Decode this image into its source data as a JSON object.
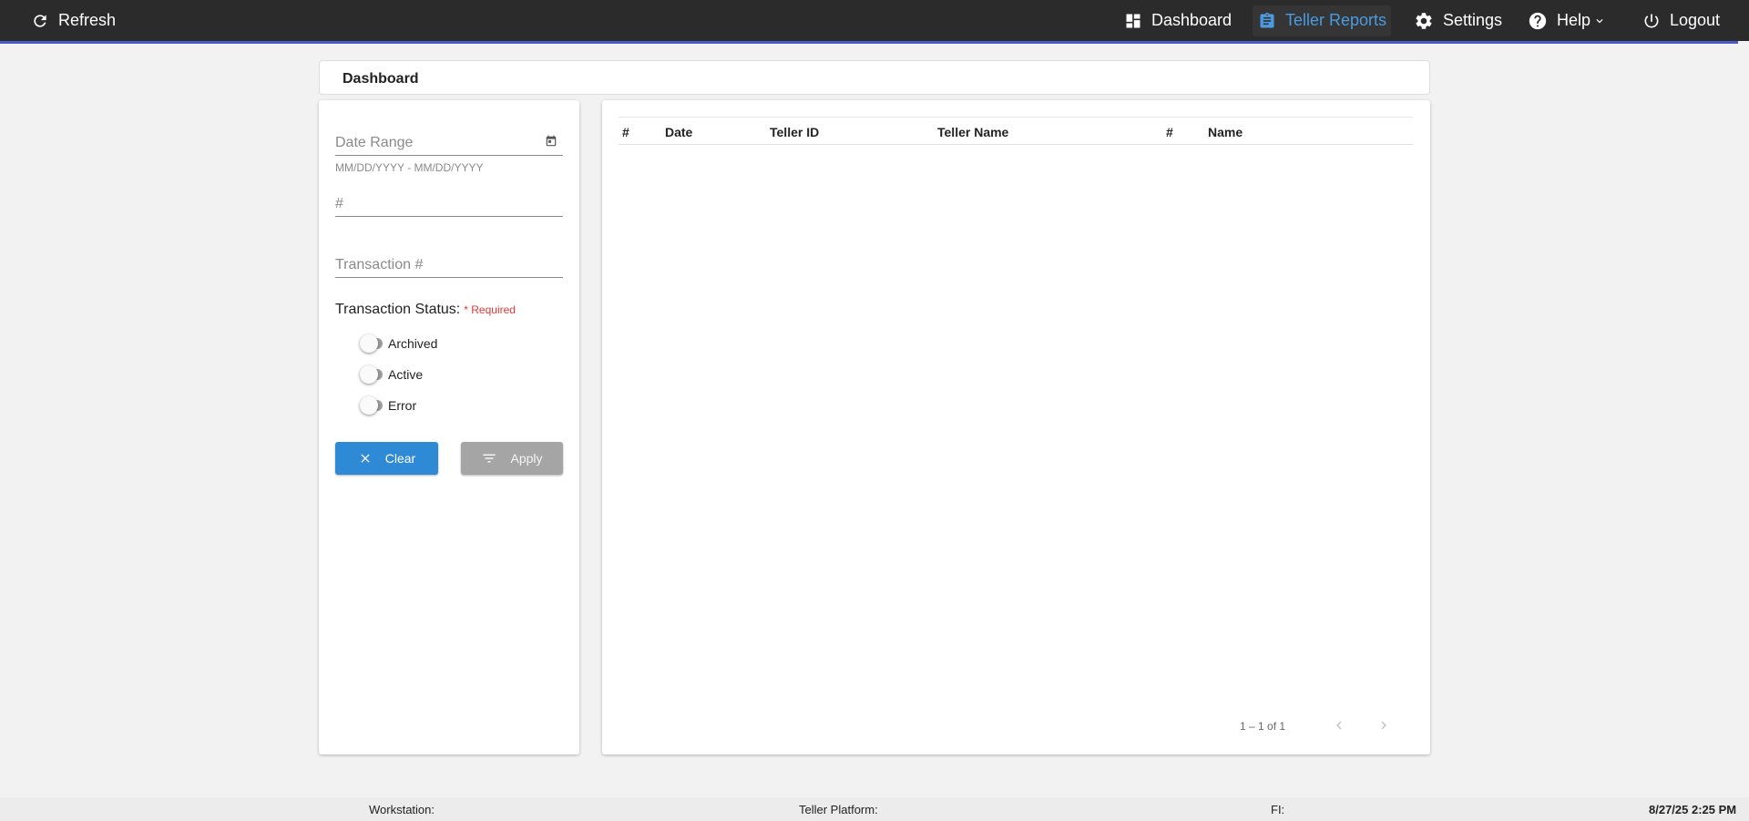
{
  "topbar": {
    "refresh_label": "Refresh",
    "nav": [
      {
        "label": "Dashboard",
        "icon": "dashboard-icon"
      },
      {
        "label": "Teller Reports",
        "icon": "clipboard-icon",
        "active": true
      },
      {
        "label": "Settings",
        "icon": "gear-icon"
      },
      {
        "label": "Help",
        "icon": "help-icon"
      },
      {
        "label": "Logout",
        "icon": "power-icon"
      }
    ],
    "accent_color": "#4a9be0",
    "underline_color": "#4a5cc4"
  },
  "breadcrumb": {
    "title": "Dashboard"
  },
  "filters": {
    "date_range": {
      "placeholder": "Date Range",
      "hint": "MM/DD/YYYY - MM/DD/YYYY",
      "value": ""
    },
    "number": {
      "placeholder": "#",
      "value": ""
    },
    "transaction": {
      "placeholder": "Transaction #",
      "value": ""
    },
    "status_label": "Transaction Status:",
    "required_label": "* Required",
    "toggles": [
      {
        "label": "Archived",
        "checked": false
      },
      {
        "label": "Active",
        "checked": false
      },
      {
        "label": "Error",
        "checked": false
      }
    ],
    "clear_label": "Clear",
    "apply_label": "Apply"
  },
  "table": {
    "columns": [
      "#",
      "Date",
      "Teller ID",
      "Teller Name",
      "#",
      "Name"
    ],
    "rows": [],
    "pagination": "1 – 1 of 1"
  },
  "footer": {
    "workstation": "Workstation:",
    "platform": "Teller Platform:",
    "fi": "FI:",
    "datetime": "8/27/25 2:25 PM"
  }
}
